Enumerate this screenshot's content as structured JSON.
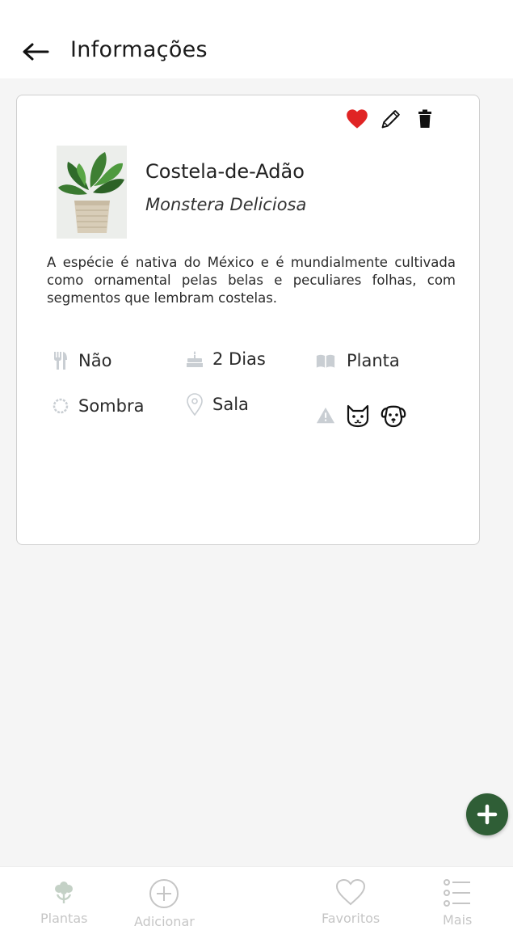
{
  "header": {
    "title": "Informações"
  },
  "plant": {
    "name": "Costela-de-Adão",
    "scientific_name": "Monstera Deliciosa",
    "description": "A espécie é nativa do México e é mundialmente cultivada como ornamental pelas belas e peculiares folhas, com segmentos que lembram costelas."
  },
  "attributes": {
    "edible": "Não",
    "watering": "2 Dias",
    "category": "Planta",
    "light": "Sombra",
    "location": "Sala"
  },
  "nav": {
    "plants": "Plantas",
    "add": "Adicionar",
    "favorites": "Favoritos",
    "more": "Mais"
  },
  "colors": {
    "accent": "#2f5e36",
    "favorite": "#e02424",
    "icon_muted": "#c9ced3"
  }
}
